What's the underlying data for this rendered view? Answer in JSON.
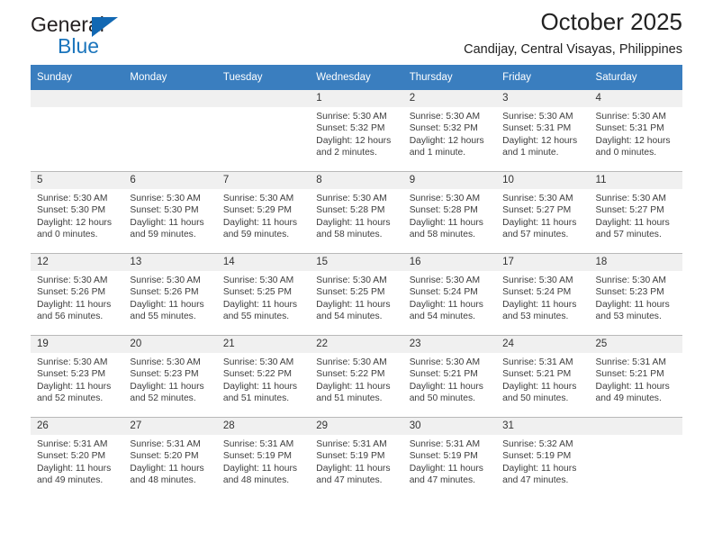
{
  "brand": {
    "name_part1": "General",
    "name_part2": "Blue",
    "triangle_color": "#1268b3",
    "blue_color": "#1b75bc"
  },
  "header": {
    "title": "October 2025",
    "subtitle": "Candijay, Central Visayas, Philippines"
  },
  "theme": {
    "header_bg": "#3a7ebf",
    "daynum_bg": "#f0f0f0",
    "grid_line": "#b9b9b9"
  },
  "weekdays": [
    "Sunday",
    "Monday",
    "Tuesday",
    "Wednesday",
    "Thursday",
    "Friday",
    "Saturday"
  ],
  "weeks": [
    [
      {
        "day": "",
        "empty": true,
        "sunrise": "",
        "sunset": "",
        "daylight1": "",
        "daylight2": ""
      },
      {
        "day": "",
        "empty": true,
        "sunrise": "",
        "sunset": "",
        "daylight1": "",
        "daylight2": ""
      },
      {
        "day": "",
        "empty": true,
        "sunrise": "",
        "sunset": "",
        "daylight1": "",
        "daylight2": ""
      },
      {
        "day": "1",
        "empty": false,
        "sunrise": "Sunrise: 5:30 AM",
        "sunset": "Sunset: 5:32 PM",
        "daylight1": "Daylight: 12 hours",
        "daylight2": "and 2 minutes."
      },
      {
        "day": "2",
        "empty": false,
        "sunrise": "Sunrise: 5:30 AM",
        "sunset": "Sunset: 5:32 PM",
        "daylight1": "Daylight: 12 hours",
        "daylight2": "and 1 minute."
      },
      {
        "day": "3",
        "empty": false,
        "sunrise": "Sunrise: 5:30 AM",
        "sunset": "Sunset: 5:31 PM",
        "daylight1": "Daylight: 12 hours",
        "daylight2": "and 1 minute."
      },
      {
        "day": "4",
        "empty": false,
        "sunrise": "Sunrise: 5:30 AM",
        "sunset": "Sunset: 5:31 PM",
        "daylight1": "Daylight: 12 hours",
        "daylight2": "and 0 minutes."
      }
    ],
    [
      {
        "day": "5",
        "empty": false,
        "sunrise": "Sunrise: 5:30 AM",
        "sunset": "Sunset: 5:30 PM",
        "daylight1": "Daylight: 12 hours",
        "daylight2": "and 0 minutes."
      },
      {
        "day": "6",
        "empty": false,
        "sunrise": "Sunrise: 5:30 AM",
        "sunset": "Sunset: 5:30 PM",
        "daylight1": "Daylight: 11 hours",
        "daylight2": "and 59 minutes."
      },
      {
        "day": "7",
        "empty": false,
        "sunrise": "Sunrise: 5:30 AM",
        "sunset": "Sunset: 5:29 PM",
        "daylight1": "Daylight: 11 hours",
        "daylight2": "and 59 minutes."
      },
      {
        "day": "8",
        "empty": false,
        "sunrise": "Sunrise: 5:30 AM",
        "sunset": "Sunset: 5:28 PM",
        "daylight1": "Daylight: 11 hours",
        "daylight2": "and 58 minutes."
      },
      {
        "day": "9",
        "empty": false,
        "sunrise": "Sunrise: 5:30 AM",
        "sunset": "Sunset: 5:28 PM",
        "daylight1": "Daylight: 11 hours",
        "daylight2": "and 58 minutes."
      },
      {
        "day": "10",
        "empty": false,
        "sunrise": "Sunrise: 5:30 AM",
        "sunset": "Sunset: 5:27 PM",
        "daylight1": "Daylight: 11 hours",
        "daylight2": "and 57 minutes."
      },
      {
        "day": "11",
        "empty": false,
        "sunrise": "Sunrise: 5:30 AM",
        "sunset": "Sunset: 5:27 PM",
        "daylight1": "Daylight: 11 hours",
        "daylight2": "and 57 minutes."
      }
    ],
    [
      {
        "day": "12",
        "empty": false,
        "sunrise": "Sunrise: 5:30 AM",
        "sunset": "Sunset: 5:26 PM",
        "daylight1": "Daylight: 11 hours",
        "daylight2": "and 56 minutes."
      },
      {
        "day": "13",
        "empty": false,
        "sunrise": "Sunrise: 5:30 AM",
        "sunset": "Sunset: 5:26 PM",
        "daylight1": "Daylight: 11 hours",
        "daylight2": "and 55 minutes."
      },
      {
        "day": "14",
        "empty": false,
        "sunrise": "Sunrise: 5:30 AM",
        "sunset": "Sunset: 5:25 PM",
        "daylight1": "Daylight: 11 hours",
        "daylight2": "and 55 minutes."
      },
      {
        "day": "15",
        "empty": false,
        "sunrise": "Sunrise: 5:30 AM",
        "sunset": "Sunset: 5:25 PM",
        "daylight1": "Daylight: 11 hours",
        "daylight2": "and 54 minutes."
      },
      {
        "day": "16",
        "empty": false,
        "sunrise": "Sunrise: 5:30 AM",
        "sunset": "Sunset: 5:24 PM",
        "daylight1": "Daylight: 11 hours",
        "daylight2": "and 54 minutes."
      },
      {
        "day": "17",
        "empty": false,
        "sunrise": "Sunrise: 5:30 AM",
        "sunset": "Sunset: 5:24 PM",
        "daylight1": "Daylight: 11 hours",
        "daylight2": "and 53 minutes."
      },
      {
        "day": "18",
        "empty": false,
        "sunrise": "Sunrise: 5:30 AM",
        "sunset": "Sunset: 5:23 PM",
        "daylight1": "Daylight: 11 hours",
        "daylight2": "and 53 minutes."
      }
    ],
    [
      {
        "day": "19",
        "empty": false,
        "sunrise": "Sunrise: 5:30 AM",
        "sunset": "Sunset: 5:23 PM",
        "daylight1": "Daylight: 11 hours",
        "daylight2": "and 52 minutes."
      },
      {
        "day": "20",
        "empty": false,
        "sunrise": "Sunrise: 5:30 AM",
        "sunset": "Sunset: 5:23 PM",
        "daylight1": "Daylight: 11 hours",
        "daylight2": "and 52 minutes."
      },
      {
        "day": "21",
        "empty": false,
        "sunrise": "Sunrise: 5:30 AM",
        "sunset": "Sunset: 5:22 PM",
        "daylight1": "Daylight: 11 hours",
        "daylight2": "and 51 minutes."
      },
      {
        "day": "22",
        "empty": false,
        "sunrise": "Sunrise: 5:30 AM",
        "sunset": "Sunset: 5:22 PM",
        "daylight1": "Daylight: 11 hours",
        "daylight2": "and 51 minutes."
      },
      {
        "day": "23",
        "empty": false,
        "sunrise": "Sunrise: 5:30 AM",
        "sunset": "Sunset: 5:21 PM",
        "daylight1": "Daylight: 11 hours",
        "daylight2": "and 50 minutes."
      },
      {
        "day": "24",
        "empty": false,
        "sunrise": "Sunrise: 5:31 AM",
        "sunset": "Sunset: 5:21 PM",
        "daylight1": "Daylight: 11 hours",
        "daylight2": "and 50 minutes."
      },
      {
        "day": "25",
        "empty": false,
        "sunrise": "Sunrise: 5:31 AM",
        "sunset": "Sunset: 5:21 PM",
        "daylight1": "Daylight: 11 hours",
        "daylight2": "and 49 minutes."
      }
    ],
    [
      {
        "day": "26",
        "empty": false,
        "sunrise": "Sunrise: 5:31 AM",
        "sunset": "Sunset: 5:20 PM",
        "daylight1": "Daylight: 11 hours",
        "daylight2": "and 49 minutes."
      },
      {
        "day": "27",
        "empty": false,
        "sunrise": "Sunrise: 5:31 AM",
        "sunset": "Sunset: 5:20 PM",
        "daylight1": "Daylight: 11 hours",
        "daylight2": "and 48 minutes."
      },
      {
        "day": "28",
        "empty": false,
        "sunrise": "Sunrise: 5:31 AM",
        "sunset": "Sunset: 5:19 PM",
        "daylight1": "Daylight: 11 hours",
        "daylight2": "and 48 minutes."
      },
      {
        "day": "29",
        "empty": false,
        "sunrise": "Sunrise: 5:31 AM",
        "sunset": "Sunset: 5:19 PM",
        "daylight1": "Daylight: 11 hours",
        "daylight2": "and 47 minutes."
      },
      {
        "day": "30",
        "empty": false,
        "sunrise": "Sunrise: 5:31 AM",
        "sunset": "Sunset: 5:19 PM",
        "daylight1": "Daylight: 11 hours",
        "daylight2": "and 47 minutes."
      },
      {
        "day": "31",
        "empty": false,
        "sunrise": "Sunrise: 5:32 AM",
        "sunset": "Sunset: 5:19 PM",
        "daylight1": "Daylight: 11 hours",
        "daylight2": "and 47 minutes."
      },
      {
        "day": "",
        "empty": true,
        "sunrise": "",
        "sunset": "",
        "daylight1": "",
        "daylight2": ""
      }
    ]
  ]
}
